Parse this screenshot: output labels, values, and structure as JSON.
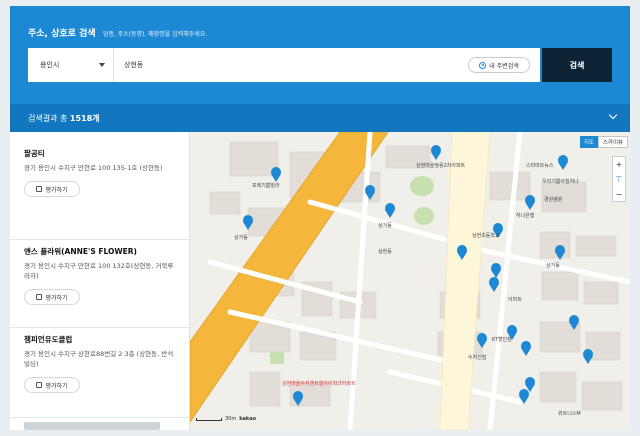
{
  "search": {
    "heading": "주소, 상호로 검색",
    "hint": "업종, 주소(동명), 매장명을 입력해주세요.",
    "region": "용인시",
    "query": "상현동",
    "nearby_label": "내 주변검색",
    "submit_label": "검색"
  },
  "results": {
    "prefix": "검색결과 총",
    "count": "1518개"
  },
  "places": [
    {
      "name": "팔공티",
      "address": "경기 용인시 수지구 만현로 100 135-1호 (상현동)",
      "review_label": "평가하기"
    },
    {
      "name": "앤스 플라워(ANNE'S FLOWER)",
      "address": "경기 용인시 수지구 만현로 100 132호(상현동, 거북루라자)",
      "review_label": "평가하기"
    },
    {
      "name": "챔피언유도클럽",
      "address": "경기 용인시 수지구 상현로88번길 2 3층 (상현동, 반석빌딩)",
      "review_label": "평가하기"
    }
  ],
  "map": {
    "type_map": "지도",
    "type_sky": "스카이뷰",
    "zoom_in": "+",
    "zoom_out": "−",
    "scale": "30m",
    "brand": "kakao",
    "labels": [
      "상현마을쌍용2차아파트",
      "포레기쁨빌라",
      "상가동",
      "상가동",
      "스타마트뉴스",
      "우리기쁨아침하나",
      "하나은행",
      "상가동",
      "상현초등학교",
      "상현마을수지센트럴아이파크아파트",
      "KT할인점",
      "수지신협",
      "이마트",
      "위트니스M",
      "상현동",
      "경원병원"
    ],
    "colors": {
      "road": "#f5b73b",
      "block": "#e3e0da",
      "park": "#c9e2b4",
      "pin": "#1d88d3"
    }
  }
}
